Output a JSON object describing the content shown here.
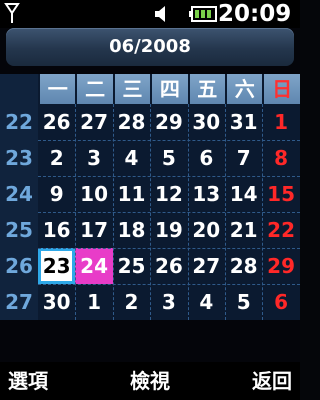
{
  "status": {
    "time": "20:09",
    "signal_icon": "signal-icon",
    "speaker_icon": "speaker-icon",
    "battery_icon": "battery-icon"
  },
  "month_label": "06/2008",
  "weekdays": [
    "一",
    "二",
    "三",
    "四",
    "五",
    "六",
    "日"
  ],
  "weeks": [
    {
      "num": "22",
      "days": [
        "26",
        "27",
        "28",
        "29",
        "30",
        "31",
        "1"
      ]
    },
    {
      "num": "23",
      "days": [
        "2",
        "3",
        "4",
        "5",
        "6",
        "7",
        "8"
      ]
    },
    {
      "num": "24",
      "days": [
        "9",
        "10",
        "11",
        "12",
        "13",
        "14",
        "15"
      ]
    },
    {
      "num": "25",
      "days": [
        "16",
        "17",
        "18",
        "19",
        "20",
        "21",
        "22"
      ]
    },
    {
      "num": "26",
      "days": [
        "23",
        "24",
        "25",
        "26",
        "27",
        "28",
        "29"
      ]
    },
    {
      "num": "27",
      "days": [
        "30",
        "1",
        "2",
        "3",
        "4",
        "5",
        "6"
      ]
    }
  ],
  "selected_day": "23",
  "today_day": "24",
  "colors": {
    "sunday": "#ff2828",
    "today_bg": "#e83cc8",
    "selected_border": "#2ea8e8",
    "header": "#6f96bc"
  },
  "softkeys": {
    "left": "選項",
    "center": "檢視",
    "right": "返回"
  }
}
